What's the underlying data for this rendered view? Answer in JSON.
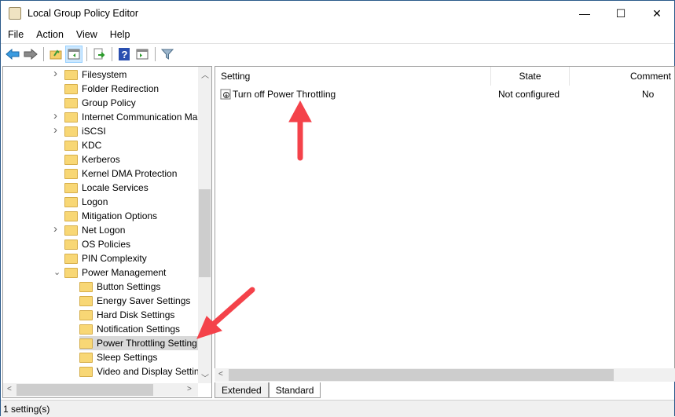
{
  "window": {
    "title": "Local Group Policy Editor",
    "minimize": "—",
    "maximize": "☐",
    "close": "✕"
  },
  "menu": [
    "File",
    "Action",
    "View",
    "Help"
  ],
  "toolbar": [
    "back-icon",
    "forward-icon",
    "up-folder-icon",
    "show-hide-tree-icon",
    "export-list-icon",
    "help-icon",
    "show-action-pane-icon",
    "filter-icon"
  ],
  "tree": [
    {
      "label": "Filesystem",
      "level": 0,
      "expandable": true
    },
    {
      "label": "Folder Redirection",
      "level": 0
    },
    {
      "label": "Group Policy",
      "level": 0
    },
    {
      "label": "Internet Communication Ma",
      "level": 0,
      "expandable": true
    },
    {
      "label": "iSCSI",
      "level": 0,
      "expandable": true
    },
    {
      "label": "KDC",
      "level": 0
    },
    {
      "label": "Kerberos",
      "level": 0
    },
    {
      "label": "Kernel DMA Protection",
      "level": 0
    },
    {
      "label": "Locale Services",
      "level": 0
    },
    {
      "label": "Logon",
      "level": 0
    },
    {
      "label": "Mitigation Options",
      "level": 0
    },
    {
      "label": "Net Logon",
      "level": 0,
      "expandable": true
    },
    {
      "label": "OS Policies",
      "level": 0
    },
    {
      "label": "PIN Complexity",
      "level": 0
    },
    {
      "label": "Power Management",
      "level": 0,
      "expanded": true
    },
    {
      "label": "Button Settings",
      "level": 1
    },
    {
      "label": "Energy Saver Settings",
      "level": 1
    },
    {
      "label": "Hard Disk Settings",
      "level": 1
    },
    {
      "label": "Notification Settings",
      "level": 1
    },
    {
      "label": "Power Throttling Setting",
      "level": 1,
      "selected": true
    },
    {
      "label": "Sleep Settings",
      "level": 1
    },
    {
      "label": "Video and Display Settin",
      "level": 1
    }
  ],
  "list": {
    "columns": [
      "Setting",
      "State",
      "Comment"
    ],
    "rows": [
      {
        "setting": "Turn off Power Throttling",
        "state": "Not configured",
        "comment": "No"
      }
    ]
  },
  "tabs": [
    "Extended",
    "Standard"
  ],
  "status": "1 setting(s)",
  "colors": {
    "annotation": "#f4424a",
    "selection": "#d9d9d9"
  }
}
